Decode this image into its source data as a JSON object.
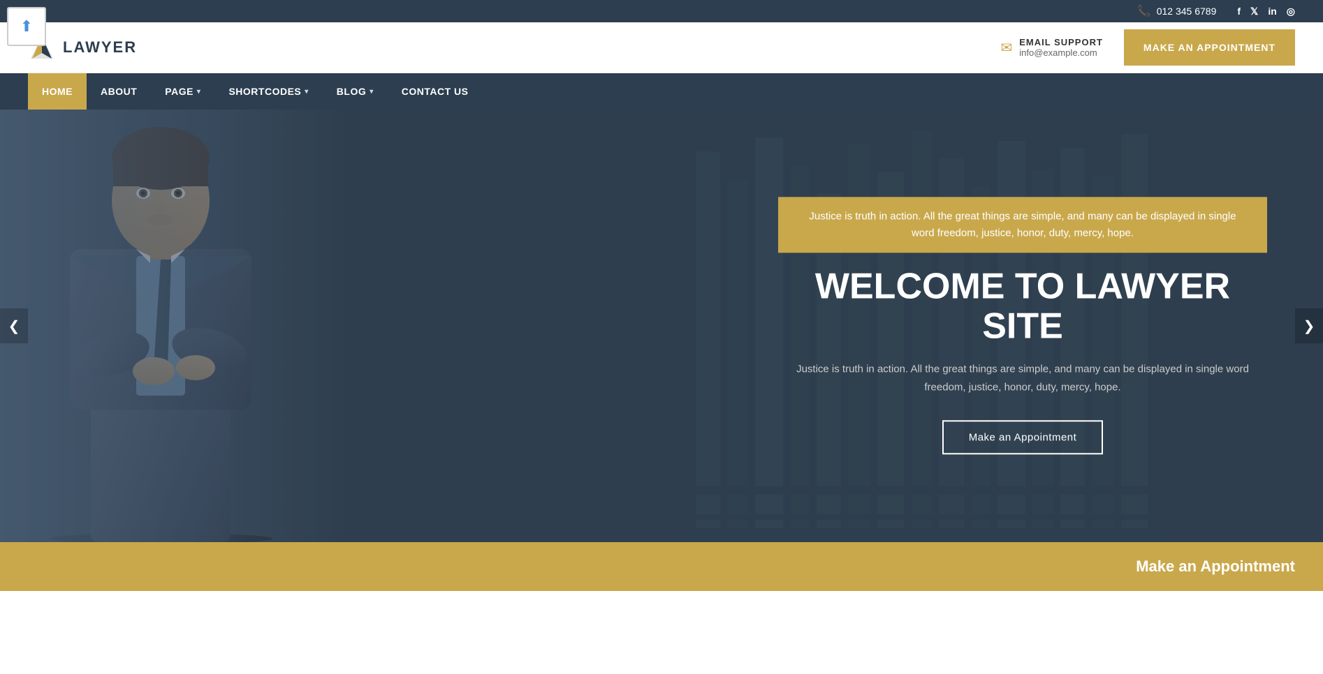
{
  "upload": {
    "icon": "⬆",
    "label": "upload"
  },
  "topbar": {
    "phone": "012 345 6789",
    "phone_icon": "📞",
    "socials": [
      {
        "name": "facebook",
        "icon": "f",
        "label": "Facebook"
      },
      {
        "name": "twitter",
        "icon": "t",
        "label": "Twitter"
      },
      {
        "name": "linkedin",
        "icon": "in",
        "label": "LinkedIn"
      },
      {
        "name": "instagram",
        "icon": "ig",
        "label": "Instagram"
      }
    ]
  },
  "header": {
    "logo_text": "LAWYER",
    "contact": {
      "icon": "✉",
      "label": "EMAIL SUPPORT",
      "email": "info@example.com"
    },
    "cta_button": "MAKE AN APPOINTMENT"
  },
  "nav": {
    "items": [
      {
        "label": "HOME",
        "active": true,
        "has_dropdown": false
      },
      {
        "label": "ABOUT",
        "active": false,
        "has_dropdown": false
      },
      {
        "label": "PAGE",
        "active": false,
        "has_dropdown": true
      },
      {
        "label": "SHORTCODES",
        "active": false,
        "has_dropdown": true
      },
      {
        "label": "BLOG",
        "active": false,
        "has_dropdown": true
      },
      {
        "label": "CONTACT US",
        "active": false,
        "has_dropdown": false
      }
    ]
  },
  "hero": {
    "tagline": "Justice is truth in action. All the great things are simple, and many can be displayed in single word freedom, justice, honor, duty, mercy, hope.",
    "title": "WELCOME TO LAWYER SITE",
    "subtitle": "Justice is truth in action. All the great things are simple, and many can be displayed in single word freedom, justice, honor, duty, mercy, hope.",
    "cta_button": "Make an Appointment",
    "slider_prev": "❮",
    "slider_next": "❯"
  },
  "appointment_section": {
    "text": "Make an Appointment"
  },
  "colors": {
    "gold": "#c9a84c",
    "dark_navy": "#2c3e50",
    "mid_navy": "#3d4f63"
  }
}
